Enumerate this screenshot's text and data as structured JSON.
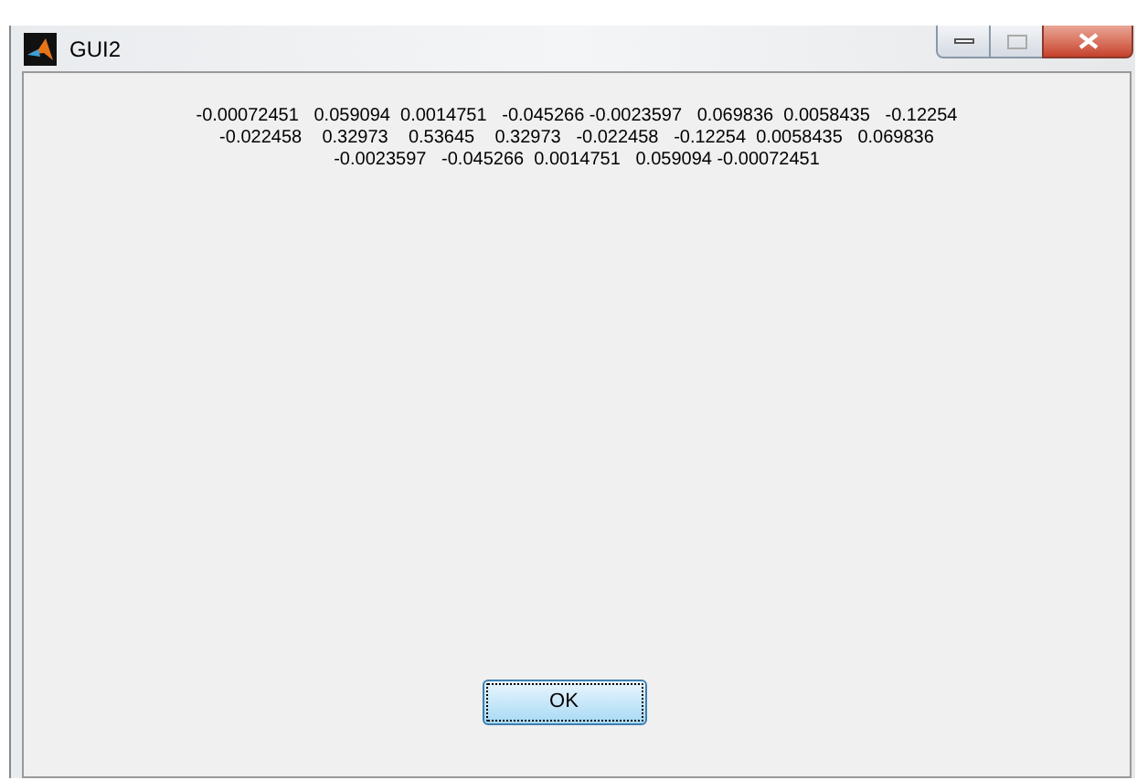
{
  "window": {
    "title": "GUI2"
  },
  "text_lines": [
    "-0.00072451   0.059094  0.0014751   -0.045266 -0.0023597   0.069836  0.0058435   -0.12254",
    "-0.022458    0.32973    0.53645    0.32973   -0.022458   -0.12254  0.0058435   0.069836",
    "-0.0023597   -0.045266  0.0014751   0.059094 -0.00072451"
  ],
  "ok_button": {
    "label": "OK",
    "focused": true
  }
}
